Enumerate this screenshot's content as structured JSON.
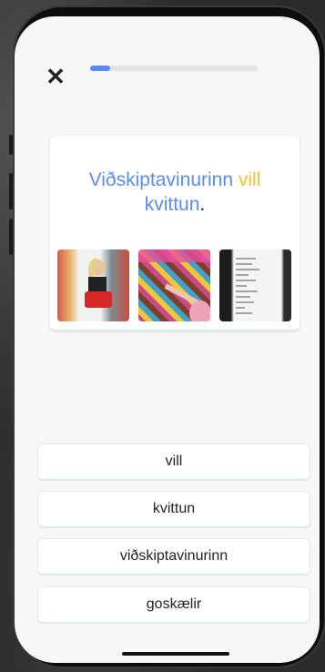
{
  "progress": {
    "fraction": 0.12
  },
  "icons": {
    "close": "close-icon"
  },
  "prompt": {
    "word1": "Viðskiptavinurinn",
    "word2": "vill",
    "word3": "kvittun",
    "end": "."
  },
  "colors": {
    "accent_blue": "#5b8def",
    "highlight_yellow": "#f2c230"
  },
  "answers": [
    "vill",
    "kvittun",
    "viðskiptavinurinn",
    "goskælir"
  ]
}
